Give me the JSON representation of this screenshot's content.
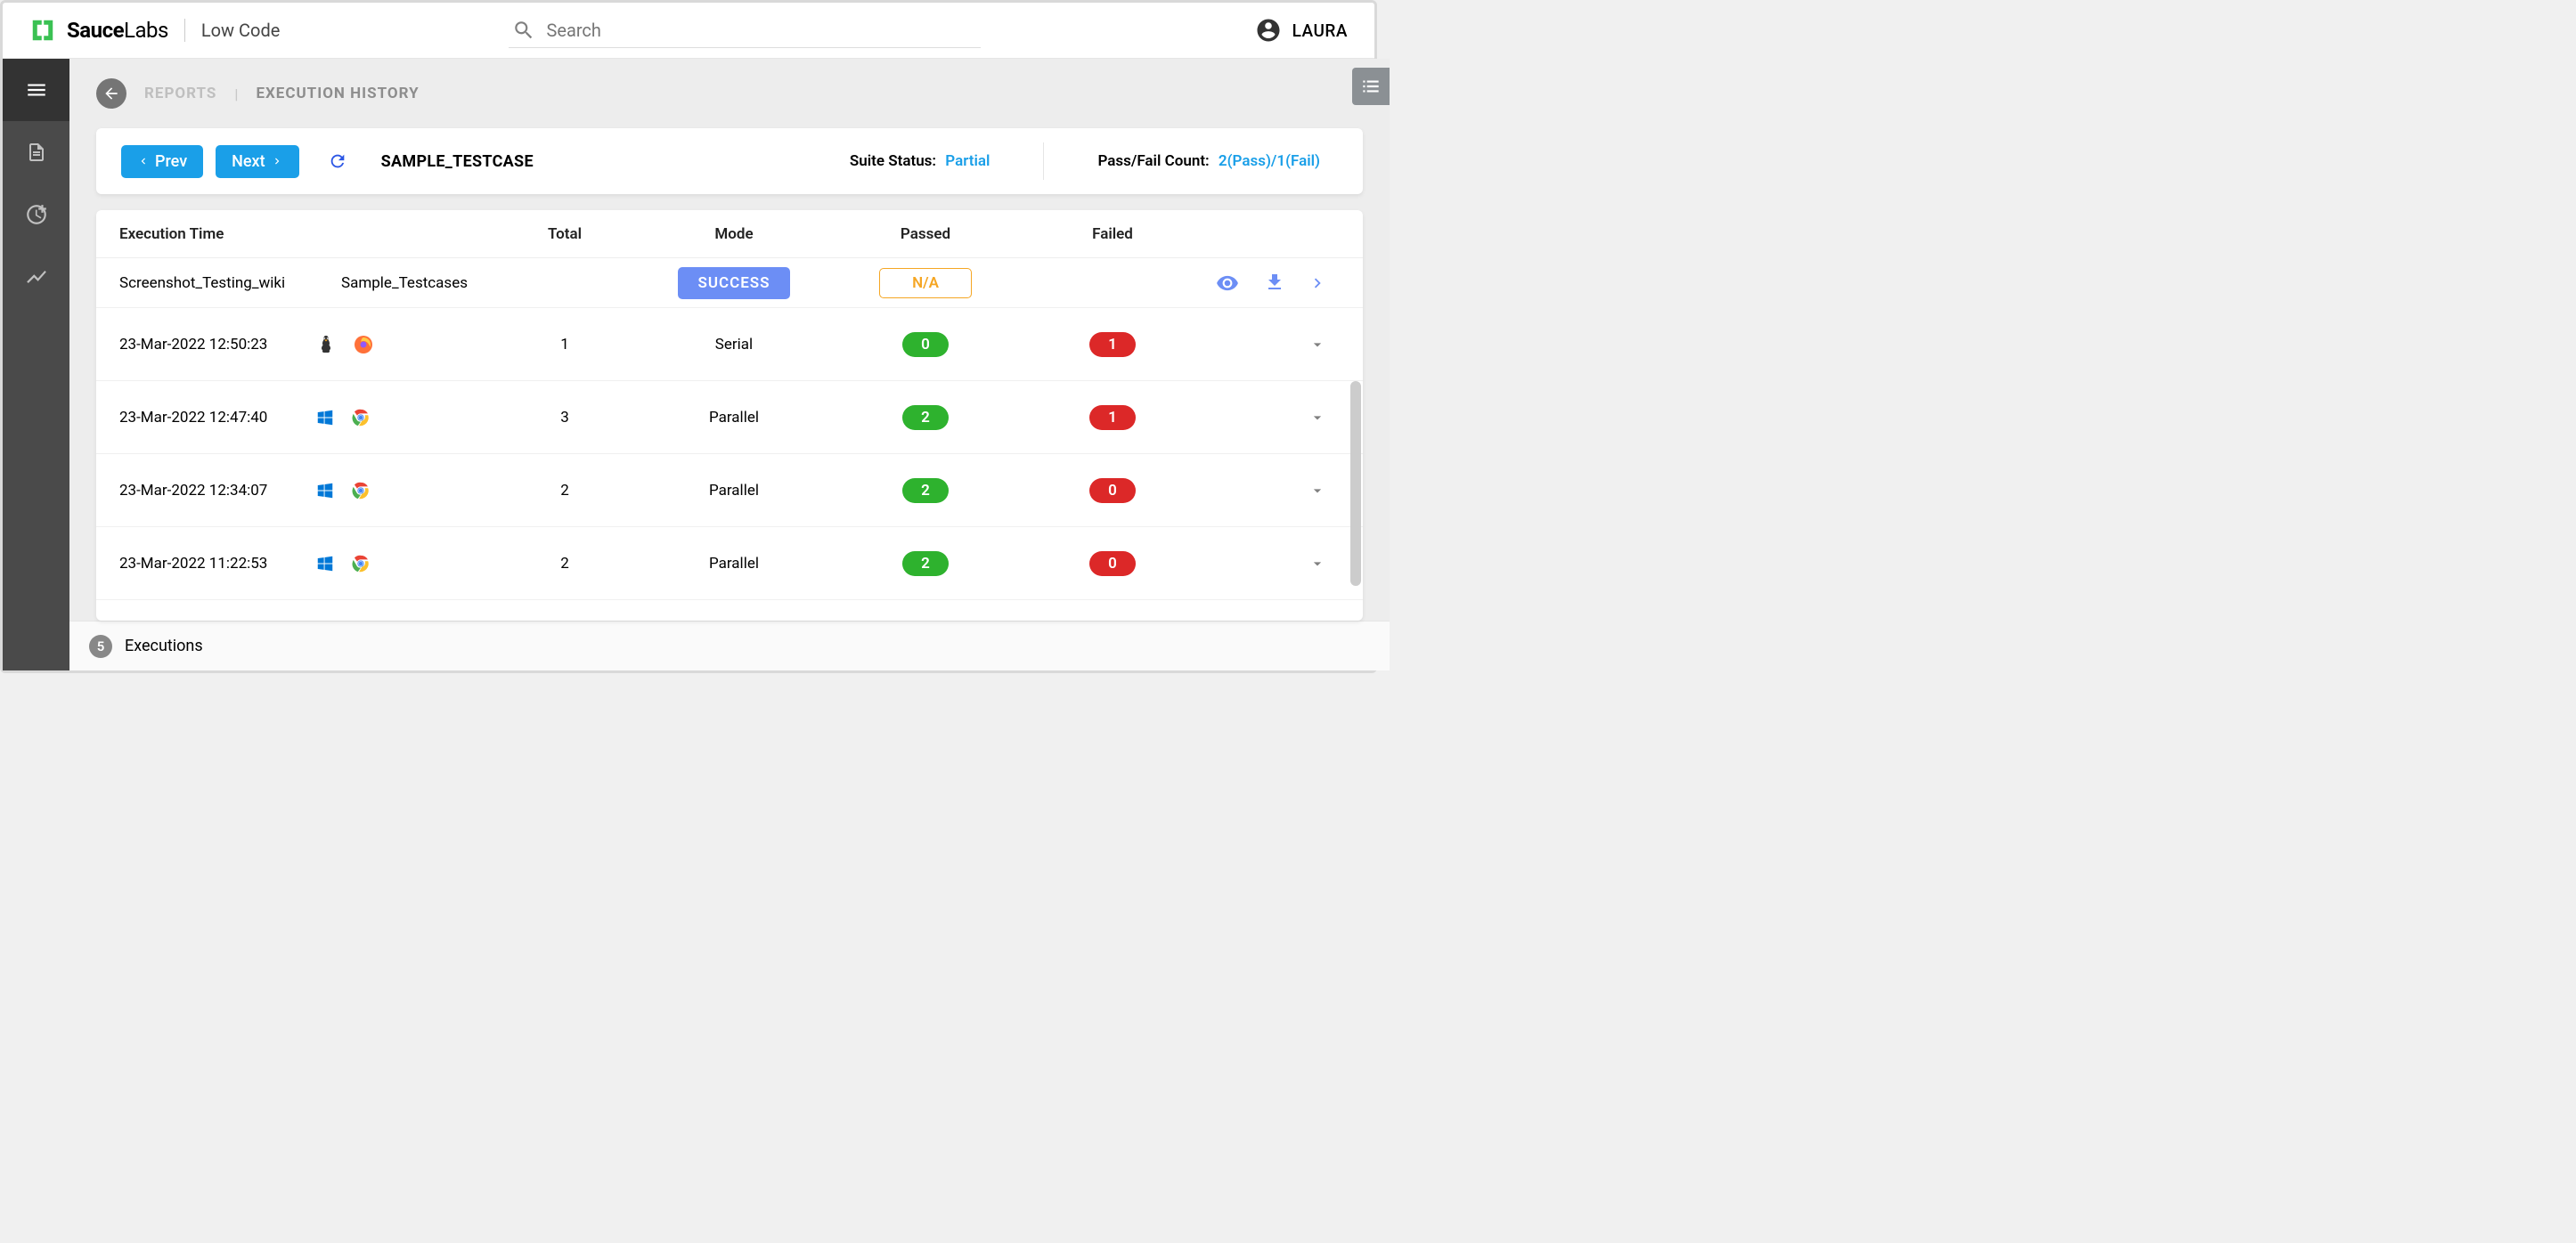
{
  "header": {
    "brand_bold": "Sauce",
    "brand_light": "Labs",
    "sub_brand": "Low Code",
    "search_placeholder": "Search",
    "user_name": "LAURA"
  },
  "breadcrumb": {
    "root": "REPORTS",
    "current": "EXECUTION HISTORY"
  },
  "topcard": {
    "prev": "Prev",
    "next": "Next",
    "title": "SAMPLE_TESTCASE",
    "suite_status_label": "Suite Status:",
    "suite_status_value": "Partial",
    "pf_label": "Pass/Fail Count:",
    "pf_value": "2(Pass)/1(Fail)"
  },
  "columns": {
    "exec_time": "Execution Time",
    "total": "Total",
    "mode": "Mode",
    "passed": "Passed",
    "failed": "Failed"
  },
  "summary_row": {
    "name": "Screenshot_Testing_wiki",
    "subtitle": "Sample_Testcases",
    "status": "SUCCESS",
    "passed": "N/A"
  },
  "rows": [
    {
      "time": "23-Mar-2022 12:50:23",
      "os": "linux",
      "browser": "firefox",
      "total": "1",
      "mode": "Serial",
      "passed": "0",
      "failed": "1"
    },
    {
      "time": "23-Mar-2022 12:47:40",
      "os": "windows",
      "browser": "chrome",
      "total": "3",
      "mode": "Parallel",
      "passed": "2",
      "failed": "1"
    },
    {
      "time": "23-Mar-2022 12:34:07",
      "os": "windows",
      "browser": "chrome",
      "total": "2",
      "mode": "Parallel",
      "passed": "2",
      "failed": "0"
    },
    {
      "time": "23-Mar-2022 11:22:53",
      "os": "windows",
      "browser": "chrome",
      "total": "2",
      "mode": "Parallel",
      "passed": "2",
      "failed": "0"
    }
  ],
  "footer": {
    "count": "5",
    "label": "Executions"
  }
}
